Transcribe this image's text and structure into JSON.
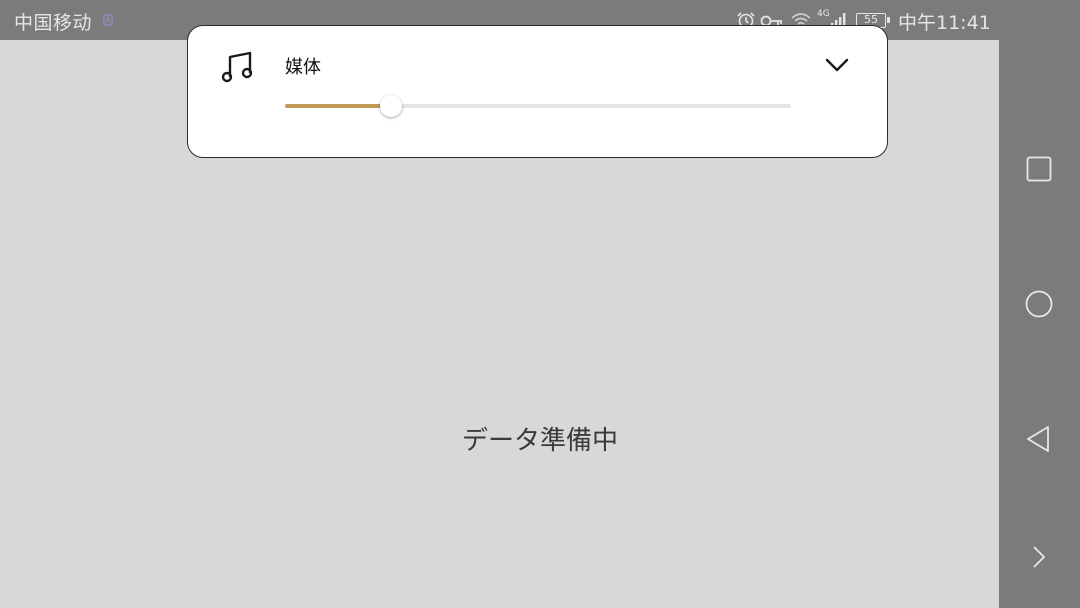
{
  "status_bar": {
    "carrier": "中国移动",
    "battery_level": "55",
    "time": "中午11:41",
    "network_type": "4G",
    "icons": [
      "alarm-icon",
      "key-icon",
      "wifi-icon",
      "signal-icon",
      "battery-icon"
    ]
  },
  "volume_panel": {
    "label": "媒体",
    "icon": "music-note-icon",
    "level_fraction": 0.21,
    "accent_color": "#c19a56"
  },
  "main": {
    "loading_text": "データ準備中"
  },
  "nav_bar": {
    "buttons": [
      "recents-button",
      "home-button",
      "back-button",
      "expand-button"
    ]
  }
}
